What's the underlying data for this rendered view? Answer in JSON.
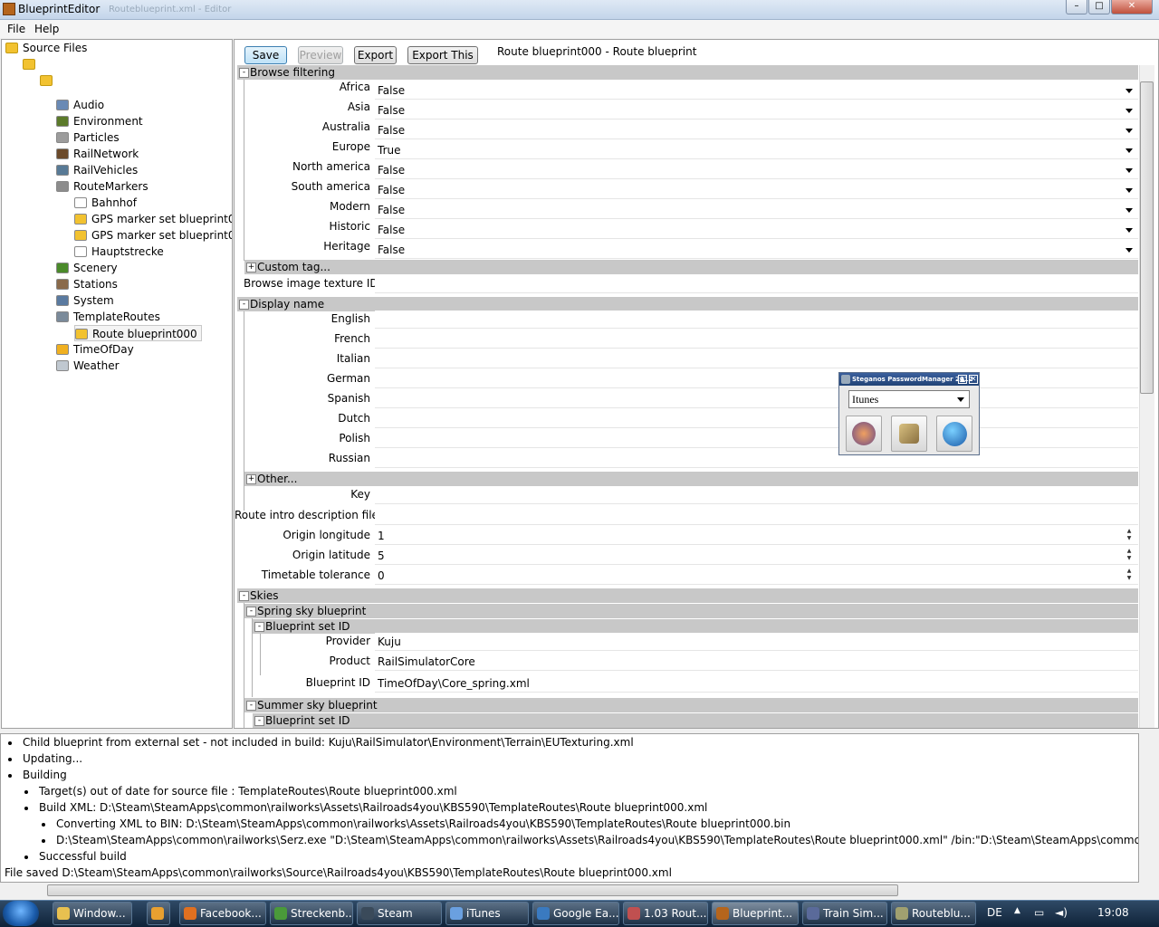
{
  "window": {
    "title": "BlueprintEditor",
    "ghost_title": "Routeblueprint.xml - Editor"
  },
  "menu": [
    "File",
    "Help"
  ],
  "tree": {
    "root": "Source Files",
    "items": [
      {
        "label": "Audio",
        "icon": "speaker-icon",
        "color": "#6a8ab5"
      },
      {
        "label": "Environment",
        "icon": "environment-icon",
        "color": "#5b7a2a"
      },
      {
        "label": "Particles",
        "icon": "particles-icon",
        "color": "#9c9c9c"
      },
      {
        "label": "RailNetwork",
        "icon": "rail-network-icon",
        "color": "#6b4a2a"
      },
      {
        "label": "RailVehicles",
        "icon": "rail-vehicles-icon",
        "color": "#587a96"
      },
      {
        "label": "RouteMarkers",
        "icon": "route-markers-icon",
        "color": "#8c8c8c"
      },
      {
        "label": "Bahnhof",
        "icon": "document-icon",
        "color": "#ffffff"
      },
      {
        "label": "GPS marker set blueprint000",
        "icon": "blueprint-icon",
        "color": "#f2c230"
      },
      {
        "label": "GPS marker set blueprint001",
        "icon": "blueprint-icon",
        "color": "#f2c230"
      },
      {
        "label": "Hauptstrecke",
        "icon": "document-icon",
        "color": "#ffffff"
      },
      {
        "label": "Scenery",
        "icon": "scenery-icon",
        "color": "#4a8a2a"
      },
      {
        "label": "Stations",
        "icon": "stations-icon",
        "color": "#8a6a4a"
      },
      {
        "label": "System",
        "icon": "system-icon",
        "color": "#5a7aa0"
      },
      {
        "label": "TemplateRoutes",
        "icon": "template-routes-icon",
        "color": "#7a8a9a"
      },
      {
        "label": "Route blueprint000",
        "icon": "blueprint-icon",
        "color": "#f2c230"
      },
      {
        "label": "TimeOfDay",
        "icon": "sun-icon",
        "color": "#f0b020"
      },
      {
        "label": "Weather",
        "icon": "weather-icon",
        "color": "#c0c8d0"
      }
    ]
  },
  "toolbar": {
    "save": "Save",
    "preview": "Preview",
    "export": "Export",
    "export_this": "Export This",
    "doc_title": "Route blueprint000 - Route blueprint"
  },
  "browse_filtering": {
    "header": "Browse filtering",
    "rows": [
      {
        "label": "Africa",
        "value": "False"
      },
      {
        "label": "Asia",
        "value": "False"
      },
      {
        "label": "Australia",
        "value": "False"
      },
      {
        "label": "Europe",
        "value": "True"
      },
      {
        "label": "North america",
        "value": "False"
      },
      {
        "label": "South america",
        "value": "False"
      },
      {
        "label": "Modern",
        "value": "False"
      },
      {
        "label": "Historic",
        "value": "False"
      },
      {
        "label": "Heritage",
        "value": "False"
      }
    ],
    "custom_tag": "Custom tag...",
    "browse_image_label": "Browse image texture ID"
  },
  "display_name": {
    "header": "Display name",
    "rows": [
      "English",
      "French",
      "Italian",
      "German",
      "Spanish",
      "Dutch",
      "Polish",
      "Russian"
    ],
    "other": "Other...",
    "key_label": "Key"
  },
  "fields": {
    "intro_label": "Route intro description filename",
    "origin_longitude_label": "Origin longitude",
    "origin_longitude": "1",
    "origin_latitude_label": "Origin latitude",
    "origin_latitude": "5",
    "timetable_label": "Timetable tolerance",
    "timetable": "0"
  },
  "skies": {
    "header": "Skies",
    "spring": "Spring sky blueprint",
    "blueprint_set_id": "Blueprint set ID",
    "provider_label": "Provider",
    "provider": "Kuju",
    "product_label": "Product",
    "product": "RailSimulatorCore",
    "blueprint_id_label": "Blueprint ID",
    "blueprint_id": "TimeOfDay\\Core_spring.xml",
    "summer": "Summer sky blueprint",
    "blueprint_set_id2": "Blueprint set ID"
  },
  "log": [
    {
      "level": 0,
      "text": "Child blueprint from external set - not included in build: Kuju\\RailSimulator\\Environment\\Terrain\\EUTexturing.xml"
    },
    {
      "level": 0,
      "text": "Updating..."
    },
    {
      "level": 0,
      "text": "Building"
    },
    {
      "level": 1,
      "text": "Target(s) out of date for source file : TemplateRoutes\\Route blueprint000.xml"
    },
    {
      "level": 1,
      "text": "Build XML: D:\\Steam\\SteamApps\\common\\railworks\\Assets\\Railroads4you\\KBS590\\TemplateRoutes\\Route blueprint000.xml"
    },
    {
      "level": 2,
      "text": "Converting XML to BIN: D:\\Steam\\SteamApps\\common\\railworks\\Assets\\Railroads4you\\KBS590\\TemplateRoutes\\Route blueprint000.bin"
    },
    {
      "level": 2,
      "text": "D:\\Steam\\SteamApps\\common\\railworks\\Serz.exe \"D:\\Steam\\SteamApps\\common\\railworks\\Assets\\Railroads4you\\KBS590\\TemplateRoutes\\Route blueprint000.xml\" /bin:\"D:\\Steam\\SteamApps\\common\\railworks\\Assets\\Railr"
    },
    {
      "level": 1,
      "text": "Successful build"
    }
  ],
  "status_line": "File saved D:\\Steam\\SteamApps\\common\\railworks\\Source\\Railroads4you\\KBS590\\TemplateRoutes\\Route blueprint000.xml",
  "password_widget": {
    "title": "Steganos PasswordManager 2012",
    "selected": "Itunes"
  },
  "taskbar": {
    "tasks": [
      {
        "label": "Window...",
        "color": "#e8c050"
      },
      {
        "label": "",
        "color": "#e8a030"
      },
      {
        "label": "Facebook...",
        "color": "#e07020"
      },
      {
        "label": "Streckenb...",
        "color": "#4a9a3a"
      },
      {
        "label": "Steam",
        "color": "#3a4a5a"
      },
      {
        "label": "iTunes",
        "color": "#6aa0e0"
      },
      {
        "label": "Google Ea...",
        "color": "#3a7ac0"
      },
      {
        "label": "1.03 Rout...",
        "color": "#c05050"
      },
      {
        "label": "Blueprint...",
        "color": "#b5651d"
      },
      {
        "label": "Train Sim...",
        "color": "#5a6a9a"
      },
      {
        "label": "Routeblu...",
        "color": "#a0a070"
      }
    ],
    "lang": "DE",
    "time": "19:08"
  }
}
